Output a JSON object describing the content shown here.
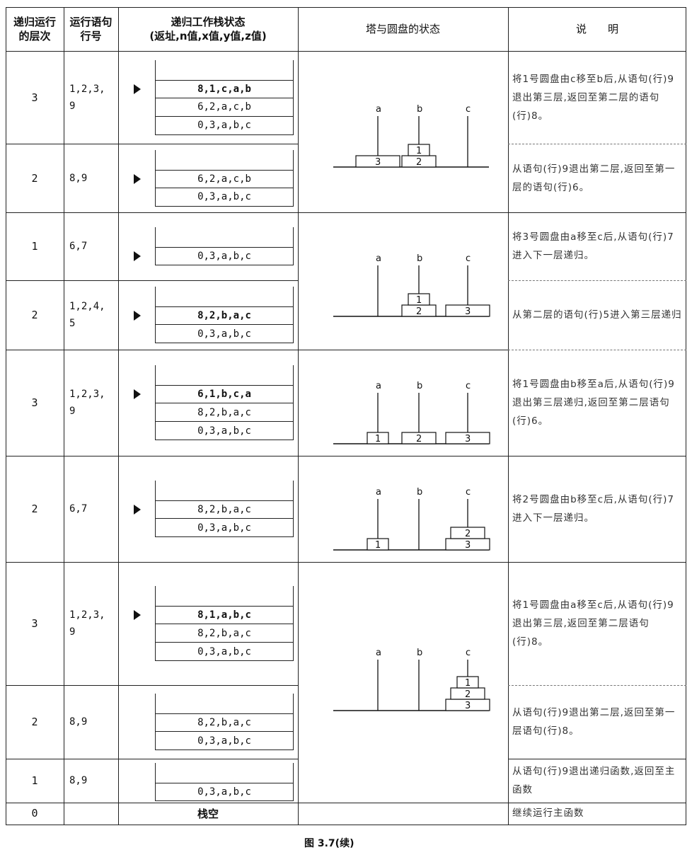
{
  "headers": {
    "col1": "递归运行的层次",
    "col2": "运行语句行号",
    "col3_line1": "递归工作栈状态",
    "col3_line2": "(返址,n值,x值,y值,z值)",
    "col4": "塔与圆盘的状态",
    "col5": "说　　明"
  },
  "rows": [
    {
      "level": "3",
      "lines": "1,2,3,\n9",
      "frames": [
        "8,1,c,a,b",
        "6,2,a,c,b",
        "0,3,a,b,c"
      ],
      "desc": "将1号圆盘由c移至b后,从语句(行)9退出第三层,返回至第二层的语句(行)8。"
    },
    {
      "level": "2",
      "lines": "8,9",
      "frames": [
        "6,2,a,c,b",
        "0,3,a,b,c"
      ],
      "desc": "从语句(行)9退出第二层,返回至第一层的语句(行)6。"
    },
    {
      "level": "1",
      "lines": "6,7",
      "frames": [
        "0,3,a,b,c"
      ],
      "desc": "将3号圆盘由a移至c后,从语句(行)7进入下一层递归。"
    },
    {
      "level": "2",
      "lines": "1,2,4,\n5",
      "frames": [
        "8,2,b,a,c",
        "0,3,a,b,c"
      ],
      "desc": "从第二层的语句(行)5进入第三层递归"
    },
    {
      "level": "3",
      "lines": "1,2,3,\n9",
      "frames": [
        "6,1,b,c,a",
        "8,2,b,a,c",
        "0,3,a,b,c"
      ],
      "desc": "将1号圆盘由b移至a后,从语句(行)9退出第三层递归,返回至第二层语句(行)6。"
    },
    {
      "level": "2",
      "lines": "6,7",
      "frames": [
        "8,2,b,a,c",
        "0,3,a,b,c"
      ],
      "desc": "将2号圆盘由b移至c后,从语句(行)7进入下一层递归。"
    },
    {
      "level": "3",
      "lines": "1,2,3,\n9",
      "frames": [
        "8,1,a,b,c",
        "8,2,b,a,c",
        "0,3,a,b,c"
      ],
      "desc": "将1号圆盘由a移至c后,从语句(行)9退出第三层,返回至第二层语句(行)8。"
    },
    {
      "level": "2",
      "lines": "8,9",
      "frames": [
        "8,2,b,a,c",
        "0,3,a,b,c"
      ],
      "desc": "从语句(行)9退出第二层,返回至第一层语句(行)8。"
    },
    {
      "level": "1",
      "lines": "8,9",
      "frames": [
        "0,3,a,b,c"
      ],
      "desc": "从语句(行)9退出递归函数,返回至主函数"
    },
    {
      "level": "0",
      "lines": "",
      "frames": [],
      "desc": "继续运行主函数",
      "empty_label": "栈空"
    }
  ],
  "towers": {
    "pegs": [
      "a",
      "b",
      "c"
    ],
    "states": [
      {
        "a": [
          3
        ],
        "b": [
          2,
          1
        ],
        "c": []
      },
      {
        "a": [],
        "b": [
          2,
          1
        ],
        "c": [
          3
        ]
      },
      {
        "a": [
          1
        ],
        "b": [
          2
        ],
        "c": [
          3
        ]
      },
      {
        "a": [
          1
        ],
        "b": [],
        "c": [
          3,
          2
        ]
      },
      {
        "a": [],
        "b": [],
        "c": [
          3,
          2,
          1
        ]
      }
    ]
  },
  "caption": "图 3.7(续)"
}
